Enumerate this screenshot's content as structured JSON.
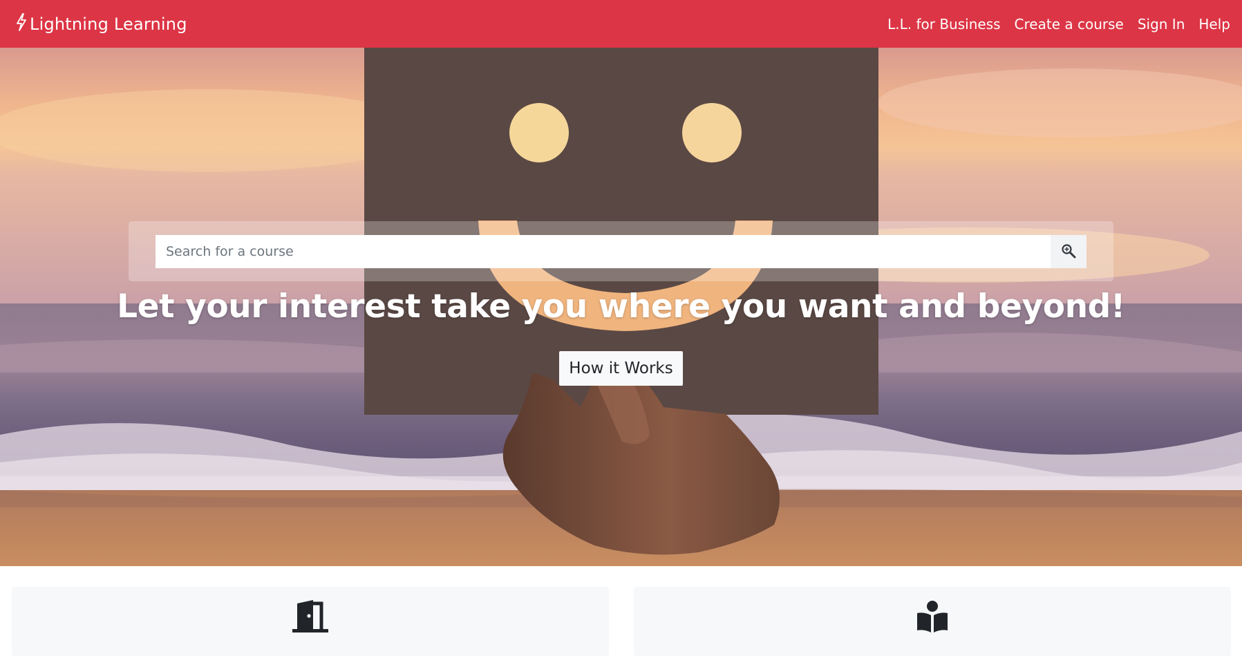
{
  "navbar": {
    "brand": "Lightning Learning",
    "links": [
      {
        "label": "L.L. for Business"
      },
      {
        "label": "Create a course"
      },
      {
        "label": "Sign In"
      },
      {
        "label": "Help"
      }
    ]
  },
  "hero": {
    "search": {
      "placeholder": "Search for a course",
      "value": ""
    },
    "heading": "Let your interest take you where you want and beyond!",
    "cta_label": "How it Works"
  },
  "features": [
    {
      "icon": "door-open-icon"
    },
    {
      "icon": "book-reader-icon"
    }
  ],
  "colors": {
    "brand": "#dc3545",
    "card_bg": "#f7f8fa",
    "text_dark": "#212529"
  }
}
